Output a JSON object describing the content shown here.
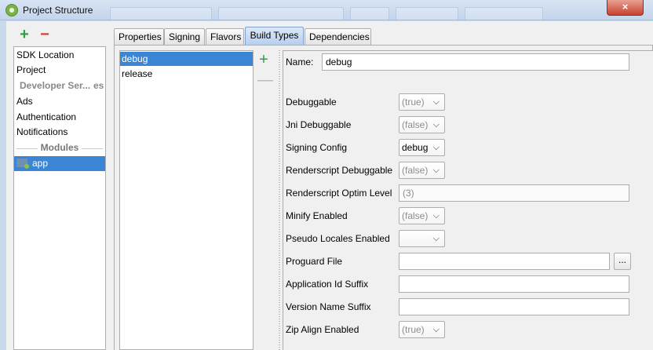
{
  "window": {
    "title": "Project Structure",
    "close_label": "×",
    "accent": "#3a86d4"
  },
  "left_panel": {
    "add_label": "+",
    "remove_label": "−",
    "items": [
      {
        "label": "SDK Location"
      },
      {
        "label": "Project"
      },
      {
        "label": "Developer Ser...",
        "suffix": "es"
      },
      {
        "label": "Ads"
      },
      {
        "label": "Authentication"
      },
      {
        "label": "Notifications"
      }
    ],
    "modules_header": "Modules",
    "modules": [
      {
        "label": "app",
        "icon": "module-folder-icon"
      }
    ]
  },
  "tabs": [
    {
      "label": "Properties"
    },
    {
      "label": "Signing"
    },
    {
      "label": "Flavors"
    },
    {
      "label": "Build Types",
      "active": true
    },
    {
      "label": "Dependencies"
    }
  ],
  "build_types": {
    "items": [
      {
        "label": "debug",
        "selected": true
      },
      {
        "label": "release"
      }
    ],
    "add_label": "+",
    "remove_label": "—"
  },
  "form": {
    "name_label": "Name:",
    "name_value": "debug",
    "fields": {
      "debuggable": {
        "label": "Debuggable",
        "value": "(true)"
      },
      "jni_debuggable": {
        "label": "Jni Debuggable",
        "value": "(false)"
      },
      "signing_config": {
        "label": "Signing Config",
        "value": "debug"
      },
      "renderscript_debuggable": {
        "label": "Renderscript Debuggable",
        "value": "(false)"
      },
      "renderscript_optim_level": {
        "label": "Renderscript Optim Level",
        "value": "(3)"
      },
      "minify_enabled": {
        "label": "Minify Enabled",
        "value": "(false)"
      },
      "pseudo_locales_enabled": {
        "label": "Pseudo Locales Enabled",
        "value": ""
      },
      "proguard_file": {
        "label": "Proguard File",
        "value": "",
        "browse_label": "..."
      },
      "application_id_suffix": {
        "label": "Application Id Suffix",
        "value": ""
      },
      "version_name_suffix": {
        "label": "Version Name Suffix",
        "value": ""
      },
      "zip_align_enabled": {
        "label": "Zip Align Enabled",
        "value": "(true)"
      }
    }
  }
}
